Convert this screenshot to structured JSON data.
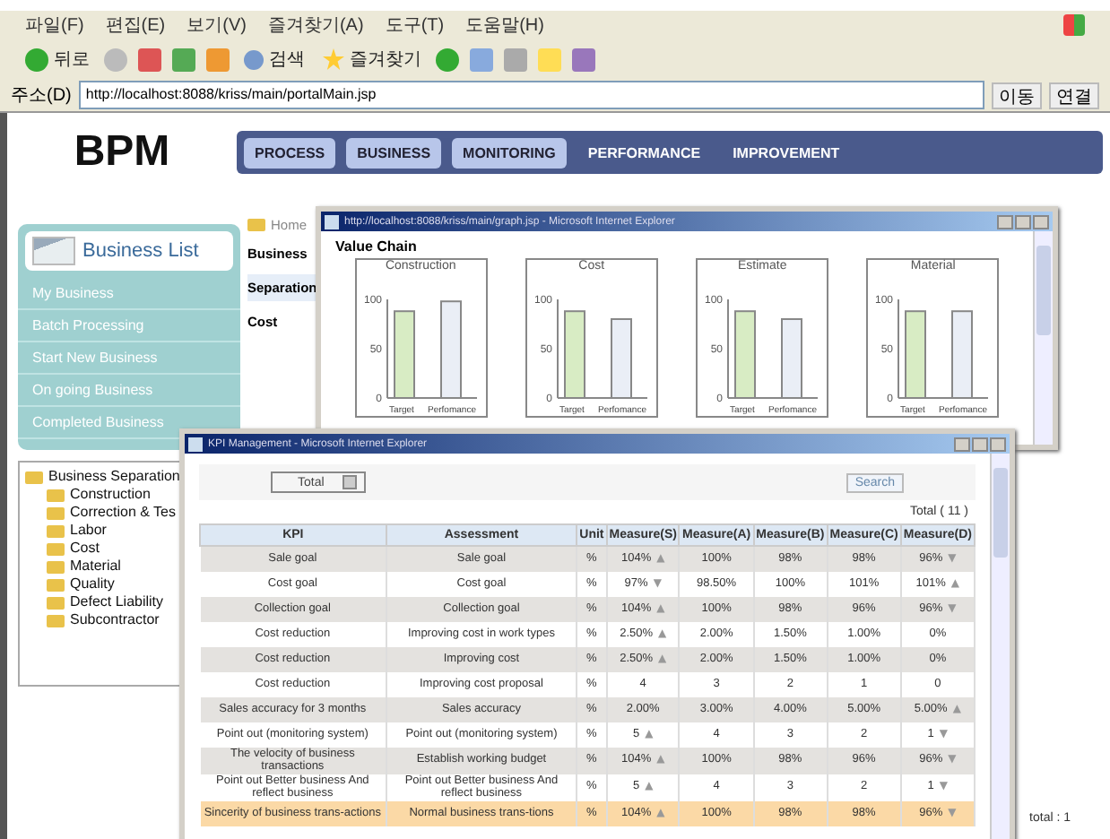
{
  "browser": {
    "menu": [
      "파일(F)",
      "편집(E)",
      "보기(V)",
      "즐겨찾기(A)",
      "도구(T)",
      "도움말(H)"
    ],
    "toolbar": {
      "back": "뒤로",
      "search": "검색",
      "favorites": "즐겨찾기"
    },
    "address": {
      "label": "주소(D)",
      "url": "http://localhost:8088/kriss/main/portalMain.jsp",
      "go": "이동",
      "links": "연결"
    }
  },
  "page": {
    "logo": "BPM",
    "nav": [
      {
        "label": "PROCESS",
        "kind": "raised"
      },
      {
        "label": "BUSINESS",
        "kind": "raised"
      },
      {
        "label": "MONITORING",
        "kind": "raised"
      },
      {
        "label": "PERFORMANCE",
        "kind": "flat"
      },
      {
        "label": "IMPROVEMENT",
        "kind": "flat"
      }
    ],
    "business_list": {
      "title": "Business List",
      "items": [
        "My Business",
        "Batch Processing",
        "Start New Business",
        "On going Business",
        "Completed Business"
      ]
    },
    "tree": {
      "label": "Business Separation",
      "children": [
        {
          "label": "Construction"
        },
        {
          "label": "Correction & Tes"
        },
        {
          "label": "Labor"
        },
        {
          "label": "Cost"
        },
        {
          "label": "Material"
        },
        {
          "label": "Quality"
        },
        {
          "label": "Defect Liability"
        },
        {
          "label": "Subcontractor"
        }
      ]
    },
    "breadcrumb": "Home",
    "labels": [
      "Business",
      "Separation",
      "Cost"
    ],
    "total": "total : 1"
  },
  "value_chain_window": {
    "title": "http://localhost:8088/kriss/main/graph.jsp - Microsoft Internet Explorer",
    "heading": "Value Chain",
    "charts": [
      {
        "chart_data": {
          "type": "bar",
          "title": "Construction",
          "categories": [
            "Target",
            "Perfomance"
          ],
          "values": [
            88,
            98
          ],
          "ylim": [
            0,
            100
          ],
          "yticks": [
            0,
            50,
            100
          ]
        }
      },
      {
        "chart_data": {
          "type": "bar",
          "title": "Cost",
          "categories": [
            "Target",
            "Perfomance"
          ],
          "values": [
            88,
            80
          ],
          "ylim": [
            0,
            100
          ],
          "yticks": [
            0,
            50,
            100
          ]
        }
      },
      {
        "chart_data": {
          "type": "bar",
          "title": "Estimate",
          "categories": [
            "Target",
            "Perfomance"
          ],
          "values": [
            88,
            80
          ],
          "ylim": [
            0,
            100
          ],
          "yticks": [
            0,
            50,
            100
          ]
        }
      },
      {
        "chart_data": {
          "type": "bar",
          "title": "Material",
          "categories": [
            "Target",
            "Perfomance"
          ],
          "values": [
            88,
            88
          ],
          "ylim": [
            0,
            100
          ],
          "yticks": [
            0,
            50,
            100
          ]
        }
      }
    ]
  },
  "kpi_window": {
    "title": "KPI Management - Microsoft Internet Explorer",
    "filter": "Total",
    "search": "Search",
    "count": "Total ( 11 )",
    "columns": [
      "KPI",
      "Assessment",
      "Unit",
      "Measure(S)",
      "Measure(A)",
      "Measure(B)",
      "Measure(C)",
      "Measure(D)"
    ],
    "rows": [
      {
        "kpi": "Sale goal",
        "assessment": "Sale goal",
        "unit": "%",
        "measures": [
          {
            "value": "104%",
            "arrow": "▲"
          },
          {
            "value": "100%"
          },
          {
            "value": "98%"
          },
          {
            "value": "98%"
          },
          {
            "value": "96%",
            "arrow": "▼"
          }
        ],
        "selected": false
      },
      {
        "kpi": "Cost goal",
        "assessment": "Cost goal",
        "unit": "%",
        "measures": [
          {
            "value": "97%",
            "arrow": "▼"
          },
          {
            "value": "98.50%"
          },
          {
            "value": "100%"
          },
          {
            "value": "101%"
          },
          {
            "value": "101%",
            "arrow": "▲"
          }
        ],
        "selected": false
      },
      {
        "kpi": "Collection goal",
        "assessment": "Collection goal",
        "unit": "%",
        "measures": [
          {
            "value": "104%",
            "arrow": "▲"
          },
          {
            "value": "100%"
          },
          {
            "value": "98%"
          },
          {
            "value": "96%"
          },
          {
            "value": "96%",
            "arrow": "▼"
          }
        ],
        "selected": false
      },
      {
        "kpi": "Cost reduction",
        "assessment": "Improving cost in work types",
        "unit": "%",
        "measures": [
          {
            "value": "2.50%",
            "arrow": "▲"
          },
          {
            "value": "2.00%"
          },
          {
            "value": "1.50%"
          },
          {
            "value": "1.00%"
          },
          {
            "value": "0%"
          }
        ],
        "selected": false
      },
      {
        "kpi": "Cost reduction",
        "assessment": "Improving cost",
        "unit": "%",
        "measures": [
          {
            "value": "2.50%",
            "arrow": "▲"
          },
          {
            "value": "2.00%"
          },
          {
            "value": "1.50%"
          },
          {
            "value": "1.00%"
          },
          {
            "value": "0%"
          }
        ],
        "selected": false
      },
      {
        "kpi": "Cost reduction",
        "assessment": "Improving cost proposal",
        "unit": "%",
        "measures": [
          {
            "value": "4"
          },
          {
            "value": "3"
          },
          {
            "value": "2"
          },
          {
            "value": "1"
          },
          {
            "value": "0"
          }
        ],
        "selected": false
      },
      {
        "kpi": "Sales accuracy for 3 months",
        "assessment": "Sales accuracy",
        "unit": "%",
        "measures": [
          {
            "value": "2.00%"
          },
          {
            "value": "3.00%"
          },
          {
            "value": "4.00%"
          },
          {
            "value": "5.00%"
          },
          {
            "value": "5.00%",
            "arrow": "▲"
          }
        ],
        "selected": false
      },
      {
        "kpi": "Point out (monitoring system)",
        "assessment": "Point out (monitoring system)",
        "unit": "%",
        "measures": [
          {
            "value": "5",
            "arrow": "▲"
          },
          {
            "value": "4"
          },
          {
            "value": "3"
          },
          {
            "value": "2"
          },
          {
            "value": "1",
            "arrow": "▼"
          }
        ],
        "selected": false
      },
      {
        "kpi": "The velocity of business transactions",
        "assessment": "Establish working budget",
        "unit": "%",
        "measures": [
          {
            "value": "104%",
            "arrow": "▲"
          },
          {
            "value": "100%"
          },
          {
            "value": "98%"
          },
          {
            "value": "96%"
          },
          {
            "value": "96%",
            "arrow": "▼"
          }
        ],
        "selected": false
      },
      {
        "kpi": "Point out Better business And reflect business",
        "assessment": "Point out Better business And reflect business",
        "unit": "%",
        "measures": [
          {
            "value": "5",
            "arrow": "▲"
          },
          {
            "value": "4"
          },
          {
            "value": "3"
          },
          {
            "value": "2"
          },
          {
            "value": "1",
            "arrow": "▼"
          }
        ],
        "selected": false
      },
      {
        "kpi": "Sincerity of business trans-actions",
        "assessment": "Normal business trans-tions",
        "unit": "%",
        "measures": [
          {
            "value": "104%",
            "arrow": "▲"
          },
          {
            "value": "100%"
          },
          {
            "value": "98%"
          },
          {
            "value": "98%"
          },
          {
            "value": "96%",
            "arrow": "▼"
          }
        ],
        "selected": true
      }
    ]
  }
}
